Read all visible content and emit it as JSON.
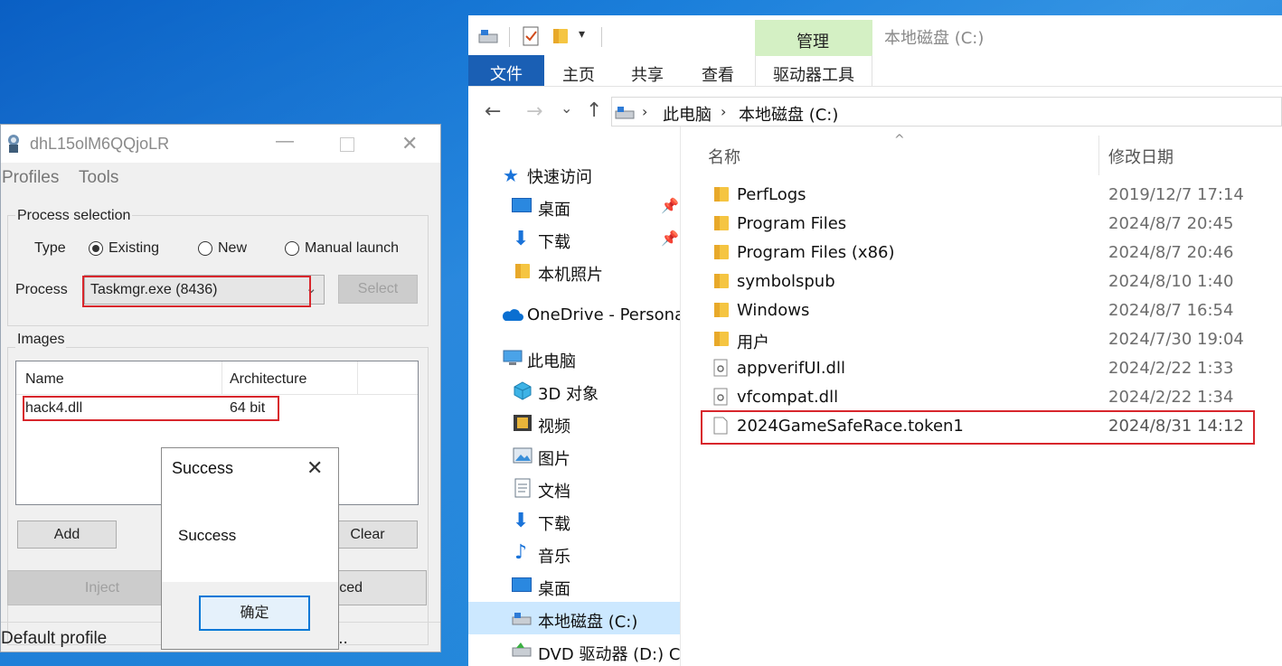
{
  "injector": {
    "title": "dhL15olM6QQjoLR",
    "menu": [
      "Profiles",
      "Tools"
    ],
    "process_selection_label": "Process selection",
    "type_label": "Type",
    "radio_existing": "Existing",
    "radio_new": "New",
    "radio_manual": "Manual launch",
    "process_label": "Process",
    "process_value": "Taskmgr.exe (8436)",
    "select_button": "Select",
    "images_label": "Images",
    "col_name": "Name",
    "col_arch": "Architecture",
    "image_name": "hack4.dll",
    "image_arch": "64 bit",
    "add_button": "Add",
    "clear_button": "Clear",
    "inject_button": "Inject",
    "advanced_button_partial": "ced",
    "status_text": "Default profile",
    "status_dots": "..."
  },
  "dialog": {
    "title": "Success",
    "message": "Success",
    "ok_button": "确定"
  },
  "explorer": {
    "contextual_tab": "管理",
    "window_title": "本地磁盘 (C:)",
    "tabs": [
      "文件",
      "主页",
      "共享",
      "查看",
      "驱动器工具"
    ],
    "breadcrumb": [
      "此电脑",
      "本地磁盘 (C:)"
    ],
    "nav": {
      "quick_access": "快速访问",
      "qa_items": [
        "桌面",
        "下载",
        "本机照片"
      ],
      "onedrive": "OneDrive - Personal",
      "this_pc": "此电脑",
      "pc_items": [
        "3D 对象",
        "视频",
        "图片",
        "文档",
        "下载",
        "音乐",
        "桌面",
        "本地磁盘 (C:)",
        "DVD 驱动器 (D:) CC"
      ]
    },
    "columns": {
      "name": "名称",
      "date": "修改日期"
    },
    "files": [
      {
        "name": "PerfLogs",
        "date": "2019/12/7 17:14",
        "kind": "folder"
      },
      {
        "name": "Program Files",
        "date": "2024/8/7 20:45",
        "kind": "folder"
      },
      {
        "name": "Program Files (x86)",
        "date": "2024/8/7 20:46",
        "kind": "folder"
      },
      {
        "name": "symbolspub",
        "date": "2024/8/10 1:40",
        "kind": "folder"
      },
      {
        "name": "Windows",
        "date": "2024/8/7 16:54",
        "kind": "folder"
      },
      {
        "name": "用户",
        "date": "2024/7/30 19:04",
        "kind": "folder"
      },
      {
        "name": "appverifUI.dll",
        "date": "2024/2/22 1:33",
        "kind": "dll"
      },
      {
        "name": "vfcompat.dll",
        "date": "2024/2/22 1:34",
        "kind": "dll"
      },
      {
        "name": "2024GameSafeRace.token1",
        "date": "2024/8/31 14:12",
        "kind": "file"
      }
    ],
    "accent": "#d8262c"
  }
}
